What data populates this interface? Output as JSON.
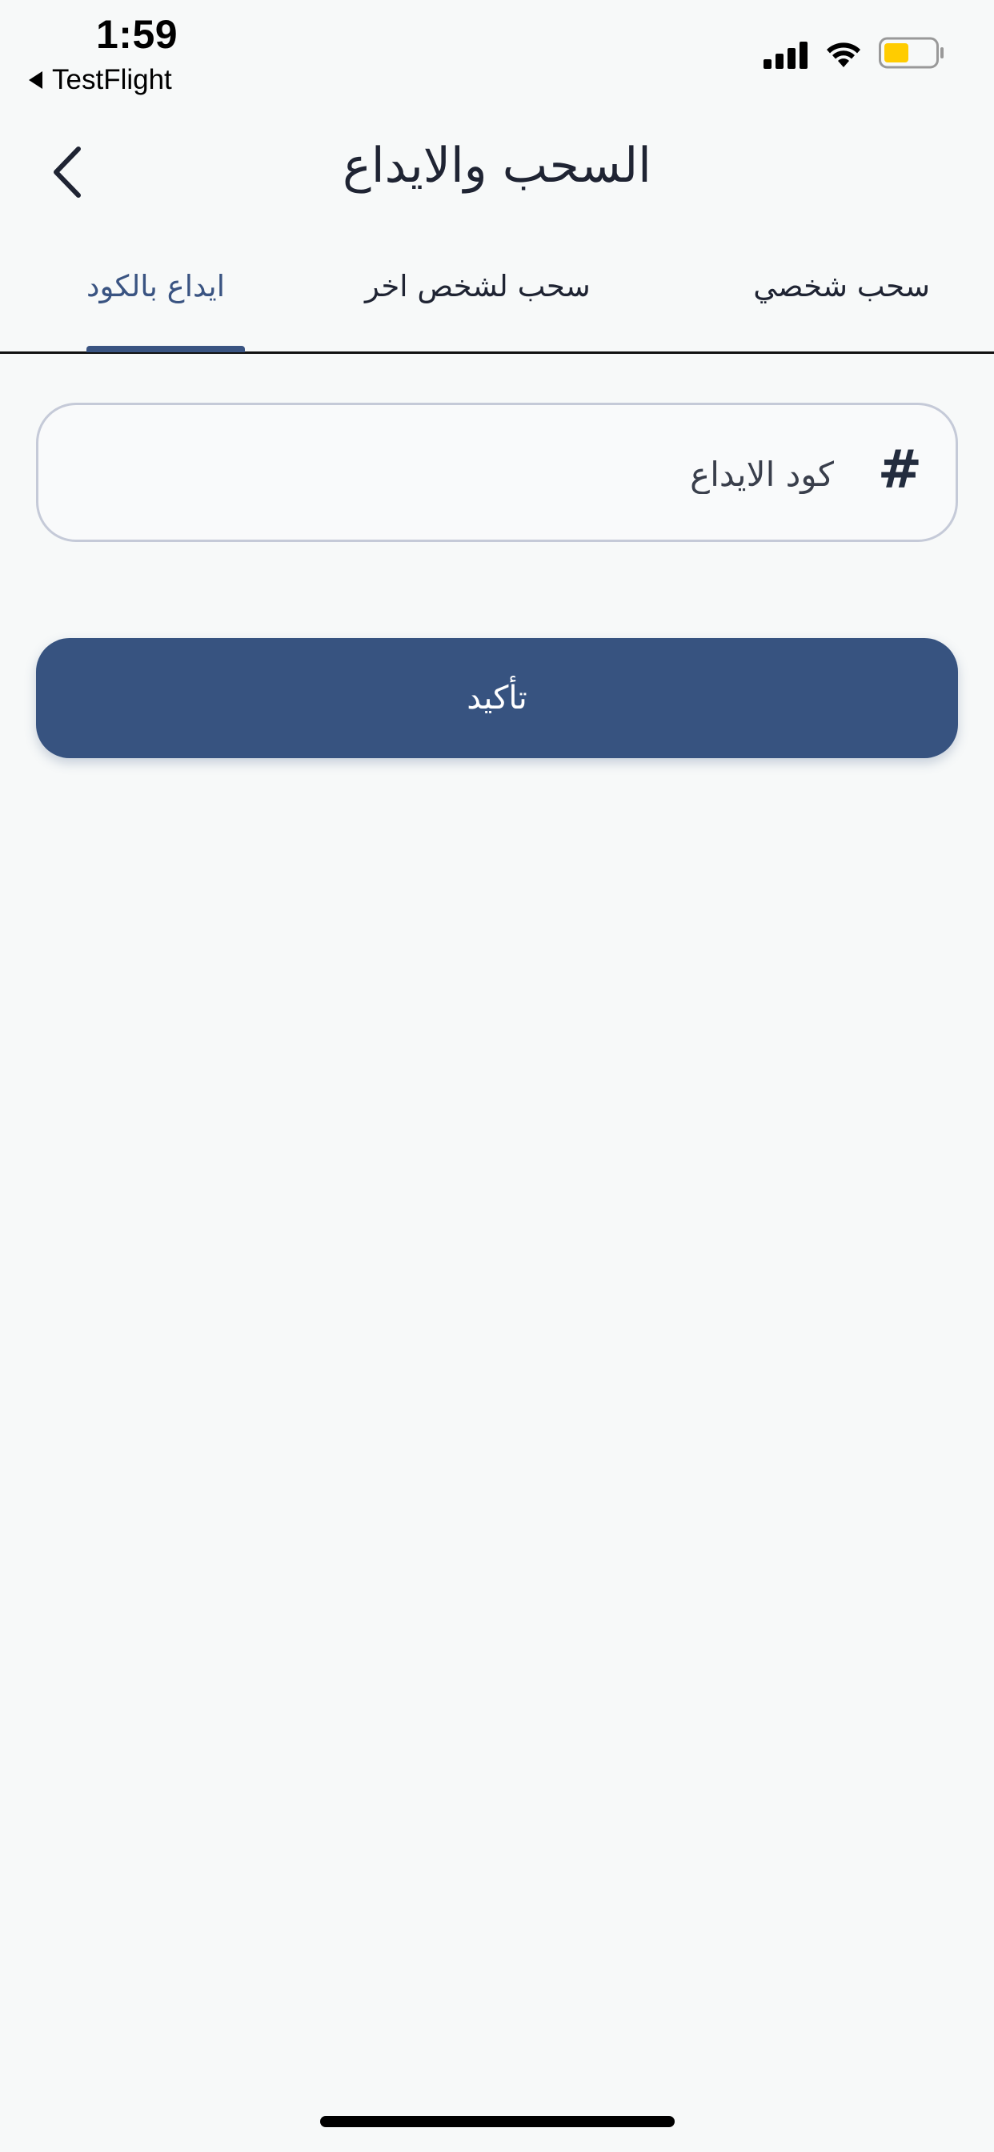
{
  "status_bar": {
    "time": "1:59",
    "back_app": "TestFlight",
    "battery_color": "#FFCC00"
  },
  "header": {
    "title": "السحب والايداع",
    "back_icon": "chevron-left-icon"
  },
  "tabs": {
    "personal_withdraw": "سحب شخصي",
    "withdraw_other": "سحب لشخص اخر",
    "deposit_by_code": "ايداع بالكود",
    "active": "deposit_by_code"
  },
  "form": {
    "deposit_code_placeholder": "كود الايداع",
    "deposit_code_value": "",
    "field_icon": "hash-icon",
    "confirm_label": "تأكيد"
  },
  "colors": {
    "primary": "#375380",
    "active_tab": "#3A5482",
    "background": "#F7F9F9",
    "field_border": "#C5CAD8"
  }
}
